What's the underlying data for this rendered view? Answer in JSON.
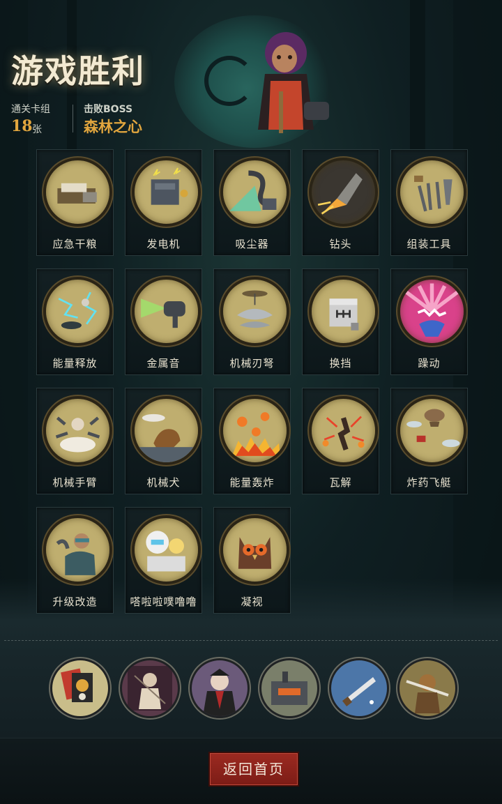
{
  "header": {
    "title": "游戏胜利",
    "deck_label": "通关卡组",
    "deck_count": "18",
    "deck_unit": "张",
    "boss_label": "击败BOSS",
    "boss_name": "森林之心"
  },
  "cards": [
    {
      "label": "应急干粮",
      "icon": "rations-icon"
    },
    {
      "label": "发电机",
      "icon": "generator-icon"
    },
    {
      "label": "吸尘器",
      "icon": "vacuum-icon"
    },
    {
      "label": "钻头",
      "icon": "drill-icon"
    },
    {
      "label": "组装工具",
      "icon": "tools-icon"
    },
    {
      "label": "能量释放",
      "icon": "energy-release-icon"
    },
    {
      "label": "金属音",
      "icon": "metal-sound-icon"
    },
    {
      "label": "机械刃弩",
      "icon": "blade-crossbow-icon"
    },
    {
      "label": "换挡",
      "icon": "gear-shift-icon"
    },
    {
      "label": "躁动",
      "icon": "frenzy-icon"
    },
    {
      "label": "机械手臂",
      "icon": "mech-arm-icon"
    },
    {
      "label": "机械犬",
      "icon": "mech-dog-icon"
    },
    {
      "label": "能量轰炸",
      "icon": "energy-bomb-icon"
    },
    {
      "label": "瓦解",
      "icon": "disintegrate-icon"
    },
    {
      "label": "炸药飞艇",
      "icon": "bomb-airship-icon"
    },
    {
      "label": "升级改造",
      "icon": "upgrade-icon"
    },
    {
      "label": "嗒啦啦噗噜噜",
      "icon": "robot-girl-icon"
    },
    {
      "label": "凝视",
      "icon": "owl-gaze-icon"
    }
  ],
  "relics": [
    {
      "icon": "skull-card-icon"
    },
    {
      "icon": "chained-figure-icon"
    },
    {
      "icon": "vampire-icon"
    },
    {
      "icon": "furnace-machine-icon"
    },
    {
      "icon": "blade-icon"
    },
    {
      "icon": "monkey-warrior-icon"
    }
  ],
  "footer": {
    "back_label": "返回首页"
  },
  "colors": {
    "accent_gold": "#e2a63e",
    "button_red": "#8e241c",
    "disc_tan": "#bfae6f"
  }
}
